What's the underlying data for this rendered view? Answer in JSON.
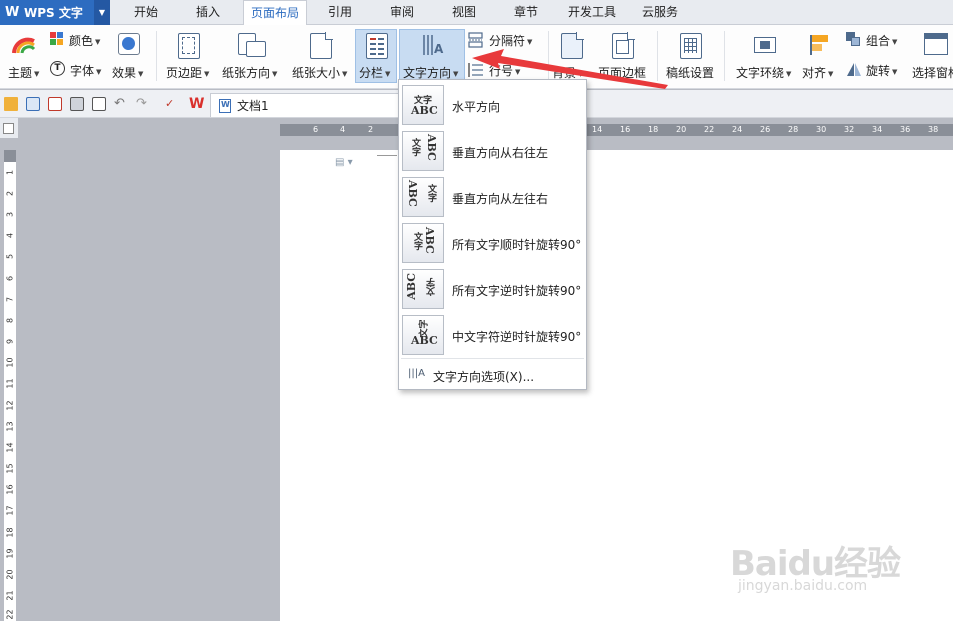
{
  "app": {
    "name": "WPS 文字"
  },
  "menu": {
    "tabs": [
      "开始",
      "插入",
      "页面布局",
      "引用",
      "审阅",
      "视图",
      "章节",
      "开发工具",
      "云服务"
    ],
    "active_tab": "页面布局"
  },
  "ribbon": {
    "theme": "主题",
    "color": "颜色",
    "font": "字体",
    "effect": "效果",
    "margin": "页边距",
    "orientation": "纸张方向",
    "size": "纸张大小",
    "columns": "分栏",
    "text_direction": "文字方向",
    "separator": "分隔符",
    "line_number": "行号",
    "background": "背景",
    "page_border": "页面边框",
    "manuscript": "稿纸设置",
    "wrap_text": "文字环绕",
    "align": "对齐",
    "group": "组合",
    "rotate": "旋转",
    "selection_pane": "选择窗格"
  },
  "document": {
    "tab_name": "文档1"
  },
  "ruler": {
    "h_left": [
      "6",
      "4",
      "2"
    ],
    "h_right": [
      "14",
      "16",
      "18",
      "20",
      "22",
      "24",
      "26",
      "28",
      "30",
      "32",
      "34",
      "36",
      "38"
    ],
    "v": [
      "1",
      "2",
      "3",
      "4",
      "5",
      "6",
      "7",
      "8",
      "9",
      "10",
      "11",
      "12",
      "13",
      "14",
      "15",
      "16",
      "17",
      "18",
      "19",
      "20",
      "21",
      "22"
    ]
  },
  "dropdown": {
    "items": [
      {
        "label": "水平方向",
        "icon": "horizontal-text-icon"
      },
      {
        "label": "垂直方向从右往左",
        "icon": "vertical-rtl-icon"
      },
      {
        "label": "垂直方向从左往右",
        "icon": "vertical-ltr-icon"
      },
      {
        "label": "所有文字顺时针旋转90°",
        "icon": "rotate-cw-icon"
      },
      {
        "label": "所有文字逆时针旋转90°",
        "icon": "rotate-ccw-icon"
      },
      {
        "label": "中文字符逆时针旋转90°",
        "icon": "rotate-cjk-ccw-icon"
      }
    ],
    "options_label": "文字方向选项(X)...",
    "icon_text": {
      "cn": "文字",
      "en": "ABC"
    }
  },
  "watermark": {
    "main": "Baidu经验",
    "sub": "jingyan.baidu.com"
  },
  "colors": {
    "accent": "#2d6cc0",
    "arrow": "#e8393b",
    "selected": "#c8dcf2"
  }
}
